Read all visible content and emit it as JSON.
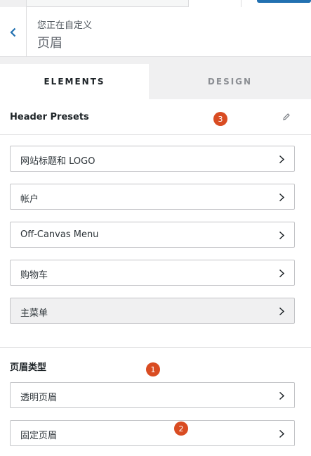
{
  "header": {
    "subtitle": "您正在自定义",
    "title": "页眉"
  },
  "tabs": [
    {
      "label": "ELEMENTS",
      "active": true
    },
    {
      "label": "DESIGN",
      "active": false
    }
  ],
  "presets": {
    "label": "Header Presets"
  },
  "elements": [
    {
      "label": "网站标题和 LOGO"
    },
    {
      "label": "帐户"
    },
    {
      "label": "Off-Canvas Menu"
    },
    {
      "label": "购物车"
    },
    {
      "label": "主菜单",
      "highlighted": true
    }
  ],
  "header_types": {
    "title": "页眉类型",
    "items": [
      {
        "label": "透明页眉"
      },
      {
        "label": "固定页眉"
      }
    ]
  },
  "badges": [
    "1",
    "2",
    "3"
  ],
  "colors": {
    "accent_blue": "#2271b1",
    "badge": "#d94c22"
  }
}
